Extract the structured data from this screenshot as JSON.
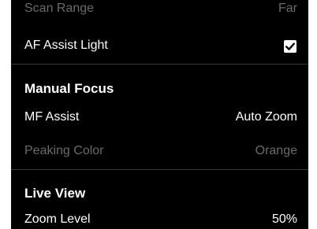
{
  "settings": {
    "scan_range": {
      "label": "Scan Range",
      "value": "Far"
    },
    "af_assist_light": {
      "label": "AF Assist Light",
      "checked": true
    },
    "manual_focus": {
      "title": "Manual Focus",
      "mf_assist": {
        "label": "MF Assist",
        "value": "Auto Zoom"
      },
      "peaking_color": {
        "label": "Peaking Color",
        "value": "Orange"
      }
    },
    "live_view": {
      "title": "Live View",
      "zoom_level": {
        "label": "Zoom Level",
        "value": "50%"
      }
    }
  },
  "icons": {
    "checkbox": "checkmark-icon"
  },
  "colors": {
    "background": "#000000",
    "text": "#ffffff",
    "disabled_text": "#6a6a6a",
    "separator": "#3a3a3a"
  }
}
